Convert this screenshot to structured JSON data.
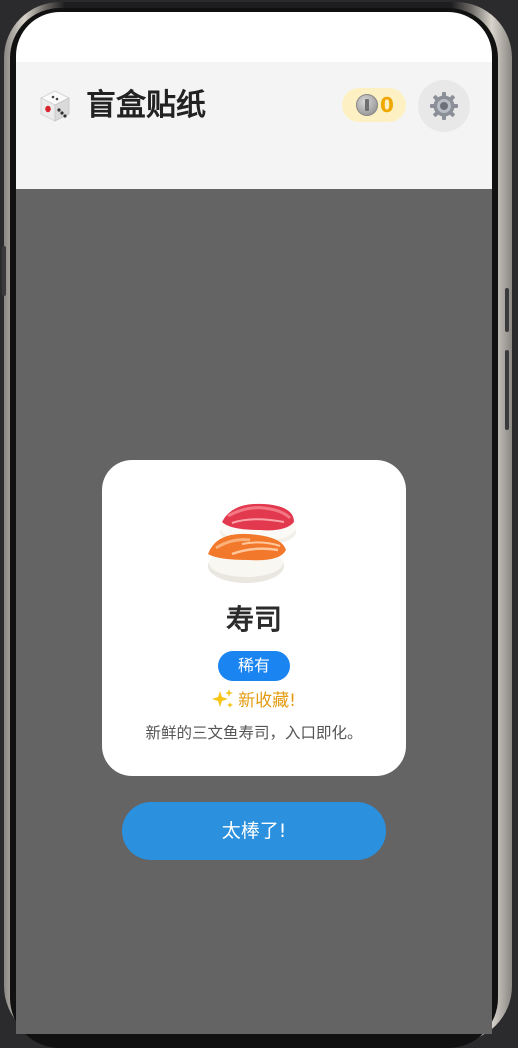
{
  "header": {
    "title": "盲盒贴纸",
    "logo_icon": "dice-icon",
    "coin_icon": "coin-icon",
    "coin_count": "0",
    "settings_icon": "gear-icon"
  },
  "dialog": {
    "sticker_icon": "sushi-icon",
    "name": "寿司",
    "rarity": "稀有",
    "new_label": "新收藏!",
    "new_icon": "sparkles-icon",
    "description": "新鲜的三文鱼寿司，入口即化。",
    "confirm_label": "太棒了!"
  },
  "colors": {
    "rarity_badge": "#1a84f1",
    "confirm_button": "#2b90de",
    "new_label": "#e39c12",
    "coin": "#f0a800",
    "overlay": "#646464"
  }
}
